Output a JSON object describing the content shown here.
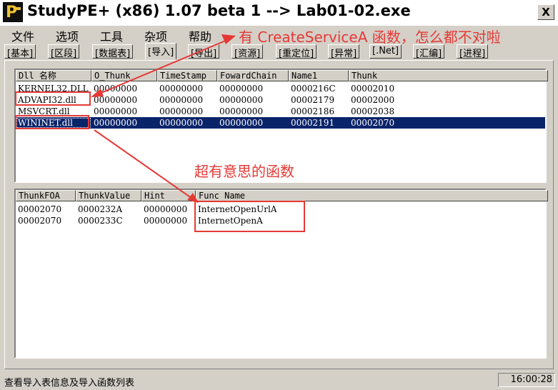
{
  "window": {
    "title": "StudyPE+ (x86) 1.07 beta 1  --> Lab01-02.exe",
    "close_label": "X"
  },
  "menu": [
    "文件",
    "选项",
    "工具",
    "杂项",
    "帮助"
  ],
  "tabs": [
    "[基本]",
    "[区段]",
    "[数据表]",
    "[导入]",
    "[导出]",
    "[资源]",
    "[重定位]",
    "[异常]",
    "[.Net]",
    "[汇编]",
    "[进程]"
  ],
  "active_tab": "[导入]",
  "dll_table": {
    "columns": [
      "Dll 名称",
      "O_Thunk",
      "TimeStamp",
      "FowardChain",
      "Name1",
      "Thunk"
    ],
    "rows": [
      [
        "KERNEL32.DLL",
        "00000000",
        "00000000",
        "00000000",
        "0000216C",
        "00002010"
      ],
      [
        "ADVAPI32.dll",
        "00000000",
        "00000000",
        "00000000",
        "00002179",
        "00002000"
      ],
      [
        "MSVCRT.dll",
        "00000000",
        "00000000",
        "00000000",
        "00002186",
        "00002038"
      ],
      [
        "WININET.dll",
        "00000000",
        "00000000",
        "00000000",
        "00002191",
        "00002070"
      ]
    ],
    "selected_row": 3
  },
  "func_table": {
    "columns": [
      "ThunkFOA",
      "ThunkValue",
      "Hint",
      "Func Name"
    ],
    "rows": [
      [
        "00002070",
        "0000232A",
        "00000000",
        "InternetOpenUrlA"
      ],
      [
        "00002070",
        "0000233C",
        "00000000",
        "InternetOpenA"
      ]
    ]
  },
  "annotations": {
    "top": "有 CreateServiceA 函数，怎么都不对啦",
    "middle": "超有意思的函数"
  },
  "status": {
    "text": "查看导入表信息及导入函数列表",
    "time": "16:00:28"
  },
  "colors": {
    "selection": "#0a246a",
    "annotation_red": "#e53935",
    "panel": "#d4d0c8"
  }
}
